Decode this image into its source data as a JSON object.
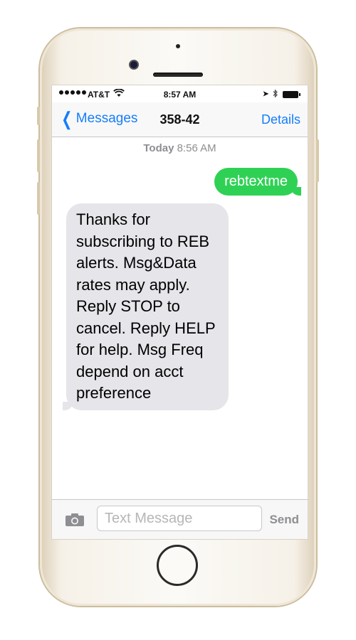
{
  "status_bar": {
    "carrier": "AT&T",
    "time": "8:57 AM",
    "signal_icon": "signal-dots-icon",
    "wifi_icon": "wifi-icon",
    "location_icon": "location-arrow-icon",
    "bluetooth_icon": "bluetooth-icon",
    "battery_icon": "battery-icon"
  },
  "nav": {
    "back_label": "Messages",
    "title": "358-42",
    "details_label": "Details"
  },
  "thread": {
    "timestamp_day": "Today",
    "timestamp_time": "8:56 AM",
    "messages": [
      {
        "direction": "outgoing",
        "text": "rebtextme"
      },
      {
        "direction": "incoming",
        "text": "Thanks for subscribing to REB alerts. Msg&Data rates may apply. Reply STOP to cancel. Reply HELP for help. Msg Freq depend on acct preference"
      }
    ]
  },
  "compose": {
    "placeholder": "Text Message",
    "value": "",
    "send_label": "Send"
  },
  "colors": {
    "accent": "#157efb",
    "outgoing_bubble": "#2fd155",
    "incoming_bubble": "#e5e5ea",
    "phone_body": "#f6f1e8"
  }
}
